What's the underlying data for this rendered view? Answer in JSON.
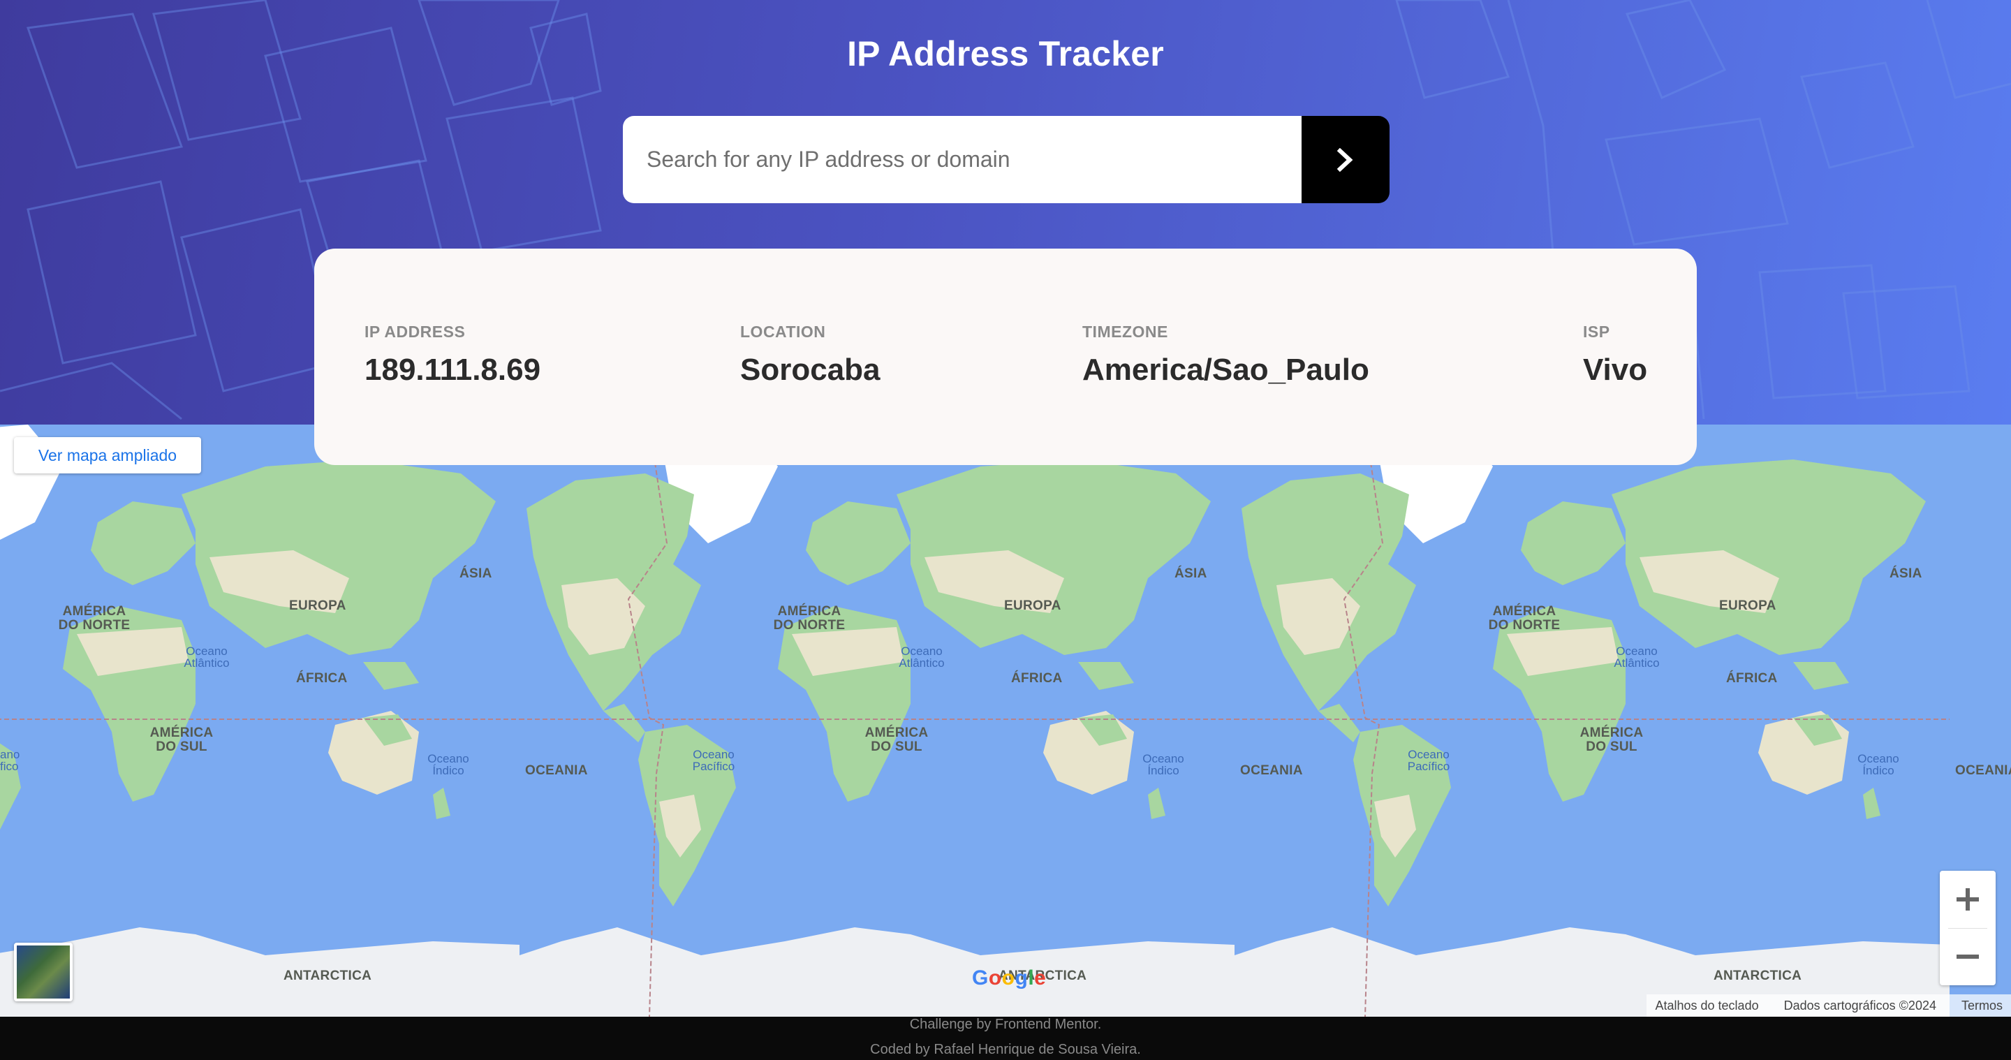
{
  "header": {
    "title": "IP Address Tracker",
    "search_placeholder": "Search for any IP address or domain",
    "search_button_icon": "chevron-right-icon"
  },
  "info": {
    "ip": {
      "label": "IP ADDRESS",
      "value": "189.111.8.69"
    },
    "location": {
      "label": "LOCATION",
      "value": "Sorocaba"
    },
    "timezone": {
      "label": "TIMEZONE",
      "value": "America/Sao_Paulo"
    },
    "isp": {
      "label": "ISP",
      "value": "Vivo"
    }
  },
  "map": {
    "enlarge_label": "Ver mapa ampliado",
    "continents": {
      "north_america": "AMÉRICA DO NORTE",
      "south_america": "AMÉRICA DO SUL",
      "europe": "EUROPA",
      "africa": "ÁFRICA",
      "asia": "ÁSIA",
      "oceania": "OCEANIA",
      "antarctica": "ANTARCTICA"
    },
    "oceans": {
      "atlantic": "Oceano Atlântico",
      "indian": "Oceano Índico",
      "pacific": "Oceano Pacífico",
      "pacific_partial": "ano fico"
    },
    "zoom_in_icon": "plus-icon",
    "zoom_out_icon": "minus-icon",
    "google_logo": "Google",
    "keyboard_shortcuts": "Atalhos do teclado",
    "map_data": "Dados cartográficos ©2024",
    "terms": "Termos"
  },
  "footer": {
    "line1": "Challenge by Frontend Mentor.",
    "line2": "Coded by Rafael Henrique de Sousa Vieira."
  },
  "colors": {
    "header_gradient_start": "#3f3b9e",
    "header_gradient_end": "#5a7df0",
    "ocean": "#7baaf1",
    "land": "#a8d6a0",
    "card": "#fbf8f7",
    "footer": "#0a0a0a"
  }
}
